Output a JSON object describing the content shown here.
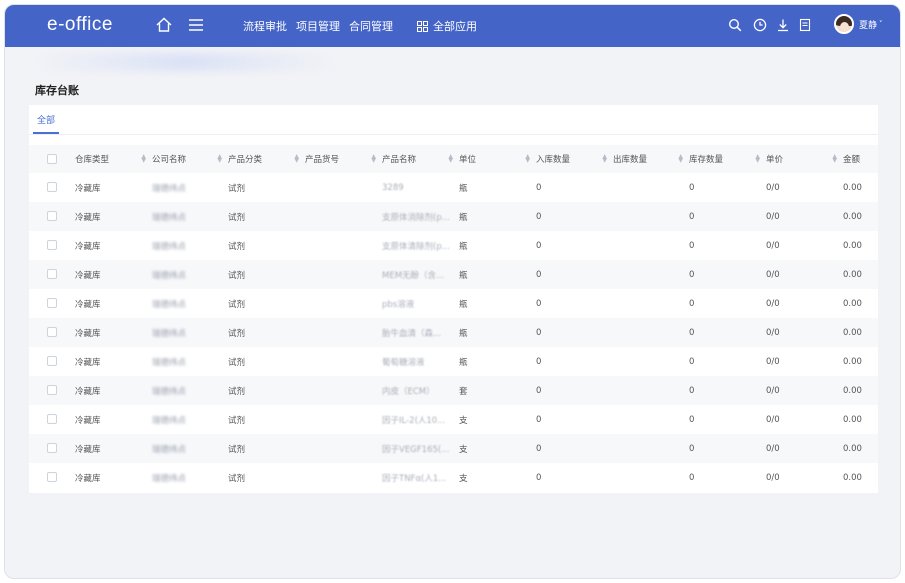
{
  "header": {
    "logo": "e-office",
    "nav": [
      "流程审批",
      "项目管理",
      "合同管理"
    ],
    "all_apps": "全部应用",
    "user_name": "夏静",
    "user_caret": "˅",
    "bg_color": "#4464c8"
  },
  "page": {
    "title": "库存台账",
    "tab_all": "全部"
  },
  "table": {
    "columns": [
      "仓库类型",
      "公司名称",
      "产品分类",
      "产品货号",
      "产品名称",
      "单位",
      "入库数量",
      "出库数量",
      "库存数量",
      "单价",
      "金额"
    ],
    "rows": [
      {
        "warehouse": "冷藏库",
        "company": "瑞德纬点",
        "category": "试剂",
        "sku": "",
        "product": "3289",
        "unit": "瓶",
        "in": "0",
        "out": "",
        "stock": "0",
        "price": "0/0",
        "amount": "0.00"
      },
      {
        "warehouse": "冷藏库",
        "company": "瑞德纬点",
        "category": "试剂",
        "sku": "",
        "product": "支原体消除剂(p...",
        "unit": "瓶",
        "in": "0",
        "out": "",
        "stock": "0",
        "price": "0/0",
        "amount": "0.00"
      },
      {
        "warehouse": "冷藏库",
        "company": "瑞德纬点",
        "category": "试剂",
        "sku": "",
        "product": "支原体清除剂(p...",
        "unit": "瓶",
        "in": "0",
        "out": "",
        "stock": "0",
        "price": "0/0",
        "amount": "0.00"
      },
      {
        "warehouse": "冷藏库",
        "company": "瑞德纬点",
        "category": "试剂",
        "sku": "",
        "product": "MEM无酚（含...",
        "unit": "瓶",
        "in": "0",
        "out": "",
        "stock": "0",
        "price": "0/0",
        "amount": "0.00"
      },
      {
        "warehouse": "冷藏库",
        "company": "瑞德纬点",
        "category": "试剂",
        "sku": "",
        "product": "pbs溶液",
        "unit": "瓶",
        "in": "0",
        "out": "",
        "stock": "0",
        "price": "0/0",
        "amount": "0.00"
      },
      {
        "warehouse": "冷藏库",
        "company": "瑞德纬点",
        "category": "试剂",
        "sku": "",
        "product": "胎牛血清（森...",
        "unit": "瓶",
        "in": "0",
        "out": "",
        "stock": "0",
        "price": "0/0",
        "amount": "0.00"
      },
      {
        "warehouse": "冷藏库",
        "company": "瑞德纬点",
        "category": "试剂",
        "sku": "",
        "product": "葡萄糖溶液",
        "unit": "瓶",
        "in": "0",
        "out": "",
        "stock": "0",
        "price": "0/0",
        "amount": "0.00"
      },
      {
        "warehouse": "冷藏库",
        "company": "瑞德纬点",
        "category": "试剂",
        "sku": "",
        "product": "内皮（ECM）",
        "unit": "套",
        "in": "0",
        "out": "",
        "stock": "0",
        "price": "0/0",
        "amount": "0.00"
      },
      {
        "warehouse": "冷藏库",
        "company": "瑞德纬点",
        "category": "试剂",
        "sku": "",
        "product": "因子IL-2(人10...",
        "unit": "支",
        "in": "0",
        "out": "",
        "stock": "0",
        "price": "0/0",
        "amount": "0.00"
      },
      {
        "warehouse": "冷藏库",
        "company": "瑞德纬点",
        "category": "试剂",
        "sku": "",
        "product": "因子VEGF165(...",
        "unit": "支",
        "in": "0",
        "out": "",
        "stock": "0",
        "price": "0/0",
        "amount": "0.00"
      },
      {
        "warehouse": "冷藏库",
        "company": "瑞德纬点",
        "category": "试剂",
        "sku": "",
        "product": "因子TNFα(人1...",
        "unit": "支",
        "in": "0",
        "out": "",
        "stock": "0",
        "price": "0/0",
        "amount": "0.00"
      }
    ]
  }
}
